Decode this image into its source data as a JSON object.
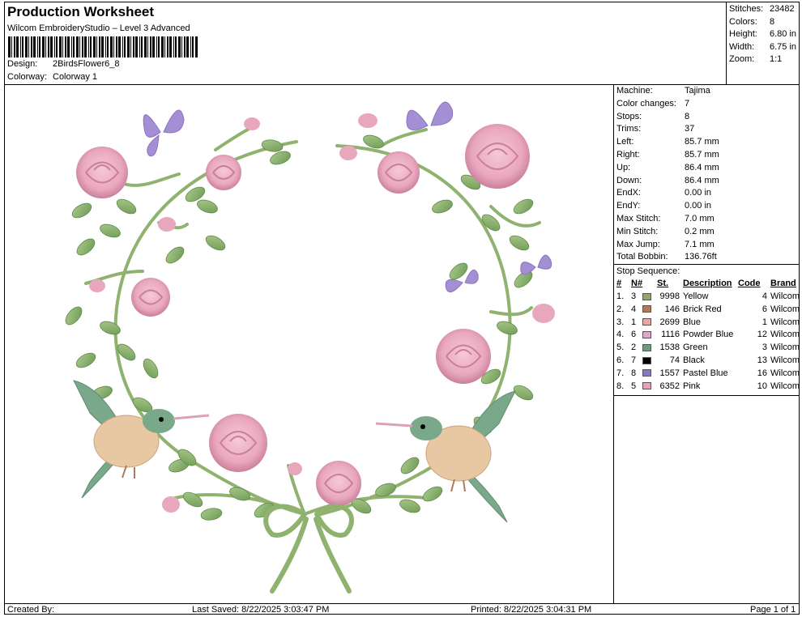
{
  "header": {
    "title": "Production Worksheet",
    "subtitle": "Wilcom EmbroideryStudio – Level 3 Advanced",
    "design_label": "Design:",
    "design_value": "2BirdsFlower6_8",
    "colorway_label": "Colorway:",
    "colorway_value": "Colorway 1"
  },
  "stats": [
    {
      "label": "Stitches:",
      "value": "23482"
    },
    {
      "label": "Colors:",
      "value": "8"
    },
    {
      "label": "Height:",
      "value": "6.80 in"
    },
    {
      "label": "Width:",
      "value": "6.75 in"
    },
    {
      "label": "Zoom:",
      "value": "1:1"
    }
  ],
  "machine_info": [
    {
      "label": "Machine:",
      "value": "Tajima"
    },
    {
      "label": "Color changes:",
      "value": "7"
    },
    {
      "label": "Stops:",
      "value": "8"
    },
    {
      "label": "Trims:",
      "value": "37"
    },
    {
      "label": "Left:",
      "value": "85.7 mm"
    },
    {
      "label": "Right:",
      "value": "85.7 mm"
    },
    {
      "label": "Up:",
      "value": "86.4 mm"
    },
    {
      "label": "Down:",
      "value": "86.4 mm"
    },
    {
      "label": "EndX:",
      "value": "0.00 in"
    },
    {
      "label": "EndY:",
      "value": "0.00 in"
    },
    {
      "label": "Max Stitch:",
      "value": "7.0 mm"
    },
    {
      "label": "Min Stitch:",
      "value": "0.2 mm"
    },
    {
      "label": "Max Jump:",
      "value": "7.1 mm"
    },
    {
      "label": "Total Bobbin:",
      "value": "136.76ft"
    }
  ],
  "stop_sequence": {
    "title": "Stop Sequence:",
    "headers": [
      "#",
      "N#",
      "St.",
      "Description",
      "Code",
      "Brand"
    ],
    "rows": [
      {
        "num": "1.",
        "n": "3",
        "st": "9998",
        "desc": "Yellow",
        "code": "4",
        "brand": "Wilcom",
        "color": "#8fa86a"
      },
      {
        "num": "2.",
        "n": "4",
        "st": "146",
        "desc": "Brick Red",
        "code": "6",
        "brand": "Wilcom",
        "color": "#b07a5c"
      },
      {
        "num": "3.",
        "n": "1",
        "st": "2699",
        "desc": "Blue",
        "code": "1",
        "brand": "Wilcom",
        "color": "#e8a6a6"
      },
      {
        "num": "4.",
        "n": "6",
        "st": "1116",
        "desc": "Powder Blue",
        "code": "12",
        "brand": "Wilcom",
        "color": "#dcaac8"
      },
      {
        "num": "5.",
        "n": "2",
        "st": "1538",
        "desc": "Green",
        "code": "3",
        "brand": "Wilcom",
        "color": "#6f9a7e"
      },
      {
        "num": "6.",
        "n": "7",
        "st": "74",
        "desc": "Black",
        "code": "13",
        "brand": "Wilcom",
        "color": "#000000"
      },
      {
        "num": "7.",
        "n": "8",
        "st": "1557",
        "desc": "Pastel Blue",
        "code": "16",
        "brand": "Wilcom",
        "color": "#8d77c4"
      },
      {
        "num": "8.",
        "n": "5",
        "st": "6352",
        "desc": "Pink",
        "code": "10",
        "brand": "Wilcom",
        "color": "#ec9ec0"
      }
    ]
  },
  "footer": {
    "created_by": "Created By:",
    "last_saved": "Last Saved: 8/22/2025 3:03:47 PM",
    "printed": "Printed: 8/22/2025 3:04:31 PM",
    "page": "Page 1 of 1"
  },
  "design_colors": {
    "rose": "#e9a7bd",
    "rose_dark": "#c97f9c",
    "leaf": "#8fb26e",
    "leaf_dark": "#5f8a4a",
    "butterfly": "#a58fd4",
    "bird_body": "#e8c7a3",
    "bird_green": "#79a98a"
  }
}
